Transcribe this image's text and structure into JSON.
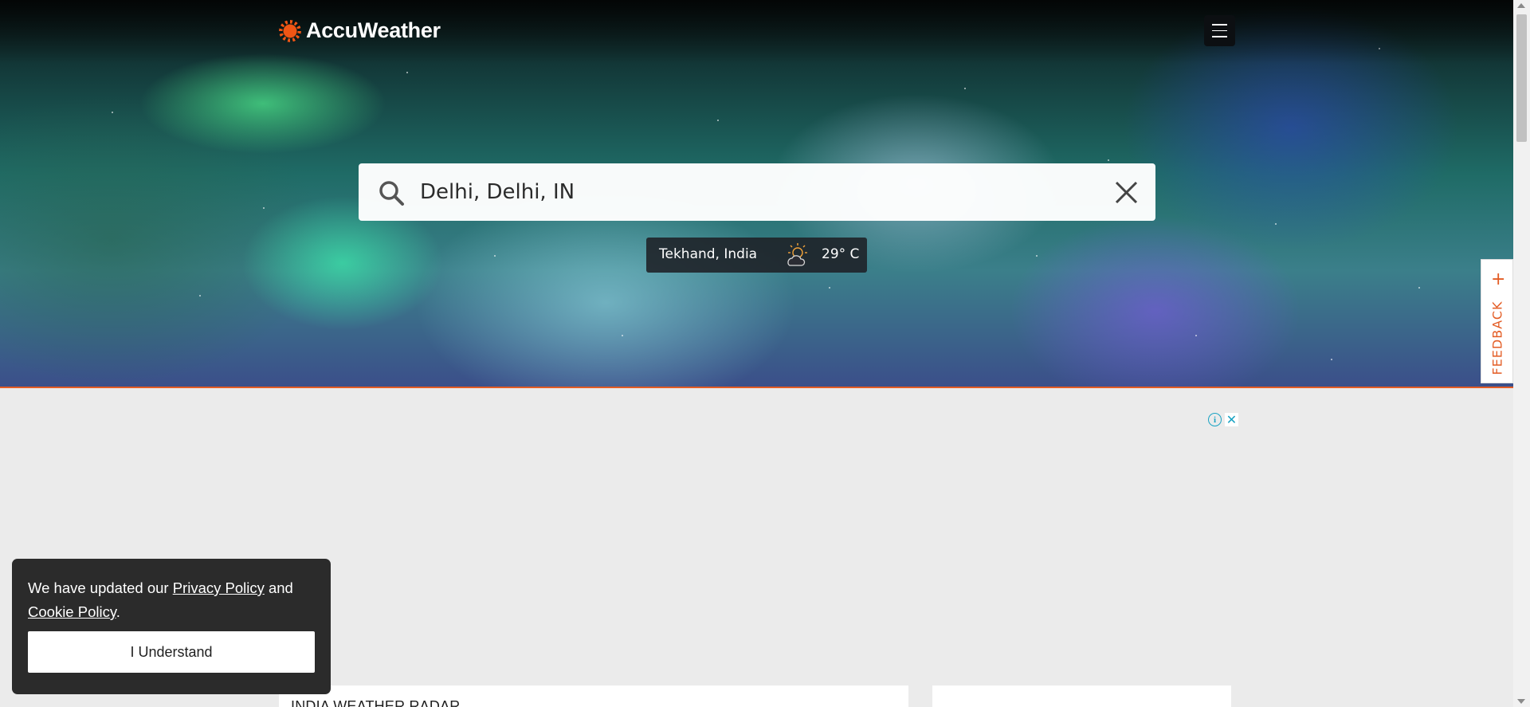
{
  "header": {
    "logo_text": "AccuWeather",
    "brand_color": "#f05514",
    "menu_icon": "hamburger-icon"
  },
  "search": {
    "value": "Delhi, Delhi, IN",
    "search_icon": "search-icon",
    "clear_icon": "close-icon"
  },
  "recent_location": {
    "name": "Tekhand, India",
    "temperature": "29° C",
    "weather_icon": "partly-sunny-icon"
  },
  "feedback": {
    "label": "FEEDBACK",
    "plus": "+"
  },
  "ad": {
    "info_icon": "info-icon",
    "close_icon": "close-icon"
  },
  "cards": {
    "radar_title": "INDIA WEATHER RADAR"
  },
  "cookie": {
    "text_before": "We have updated our ",
    "privacy_link": "Privacy Policy",
    "text_middle": " and ",
    "cookie_link": "Cookie Policy",
    "text_after": ".",
    "button_label": "I Understand"
  },
  "colors": {
    "accent": "#e35c24",
    "ad_accent": "#1aa3c3",
    "cookie_bg": "#2b2b2b"
  }
}
